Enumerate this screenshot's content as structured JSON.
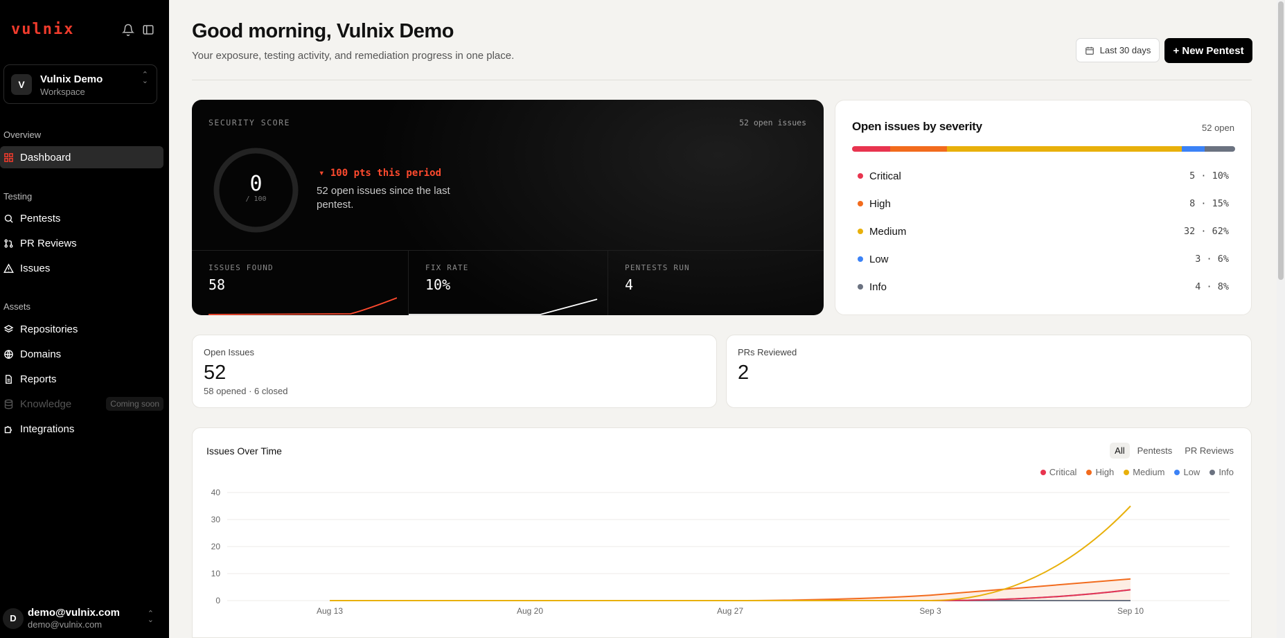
{
  "sidebar": {
    "logo": "vulnix",
    "workspace": {
      "avatar": "V",
      "name": "Vulnix Demo",
      "type": "Workspace"
    },
    "sections": {
      "overview": "Overview",
      "testing": "Testing",
      "assets": "Assets"
    },
    "items": [
      {
        "label": "Dashboard",
        "icon": "dashboard-icon",
        "active": true
      },
      {
        "label": "Pentests",
        "icon": "search-icon"
      },
      {
        "label": "PR Reviews",
        "icon": "git-pull-request-icon"
      },
      {
        "label": "Issues",
        "icon": "warning-triangle-icon"
      },
      {
        "label": "Repositories",
        "icon": "layers-icon"
      },
      {
        "label": "Domains",
        "icon": "globe-icon"
      },
      {
        "label": "Reports",
        "icon": "document-icon"
      },
      {
        "label": "Knowledge",
        "icon": "database-icon",
        "disabled": true,
        "badge": "Coming soon"
      },
      {
        "label": "Integrations",
        "icon": "puzzle-icon"
      }
    ],
    "user": {
      "avatar": "D",
      "email": "demo@vulnix.com",
      "sub": "demo@vulnix.com"
    }
  },
  "header": {
    "title": "Good morning, Vulnix Demo",
    "subtitle": "Your exposure, testing activity, and remediation progress in one place.",
    "range_label": "Last 30 days",
    "new_pentest_label": "+ New Pentest"
  },
  "security": {
    "label": "SECURITY SCORE",
    "open_issues": "52 open issues",
    "score": "0",
    "score_of": "/ 100",
    "delta": "▾ 100 pts this period",
    "delta_text": "52 open issues since the last pentest.",
    "stats": [
      {
        "label": "ISSUES FOUND",
        "value": "58"
      },
      {
        "label": "FIX RATE",
        "value": "10%"
      },
      {
        "label": "PENTESTS RUN",
        "value": "4"
      }
    ]
  },
  "severity": {
    "title": "Open issues by severity",
    "open": "52 open",
    "rows": [
      {
        "name": "Critical",
        "value": "5 · 10%",
        "color": "#e8344f",
        "pct": 10
      },
      {
        "name": "High",
        "value": "8 · 15%",
        "color": "#f26b1d",
        "pct": 15
      },
      {
        "name": "Medium",
        "value": "32 · 62%",
        "color": "#e8b00b",
        "pct": 62
      },
      {
        "name": "Low",
        "value": "3 · 6%",
        "color": "#3b82f6",
        "pct": 6
      },
      {
        "name": "Info",
        "value": "4 · 8%",
        "color": "#6b7280",
        "pct": 8
      }
    ]
  },
  "cards": {
    "open_issues": {
      "label": "Open Issues",
      "value": "52",
      "sub": "58 opened · 6 closed"
    },
    "prs_reviewed": {
      "label": "PRs Reviewed",
      "value": "2"
    }
  },
  "chart_section": {
    "title": "Issues Over Time",
    "tabs": [
      "All",
      "Pentests",
      "PR Reviews"
    ],
    "active_tab": "All"
  },
  "chart_data": {
    "type": "line",
    "x": [
      "Aug 13",
      "Aug 20",
      "Aug 27",
      "Sep 3",
      "Sep 10"
    ],
    "x_ticks": [
      "Aug 13",
      "Aug 20",
      "Aug 27",
      "Sep 3",
      "Sep 10"
    ],
    "y_ticks": [
      "0",
      "10",
      "20",
      "30",
      "40"
    ],
    "ylim": [
      0,
      40
    ],
    "grid": true,
    "legend_position": "top-right",
    "series": [
      {
        "name": "Critical",
        "color": "#e8344f",
        "values": [
          0,
          0,
          0,
          0,
          4
        ]
      },
      {
        "name": "High",
        "color": "#f26b1d",
        "values": [
          0,
          0,
          0,
          2,
          8
        ]
      },
      {
        "name": "Medium",
        "color": "#e8b00b",
        "values": [
          0,
          0,
          0,
          0,
          35
        ]
      },
      {
        "name": "Low",
        "color": "#3b82f6",
        "values": [
          0,
          0,
          0,
          0,
          4
        ]
      },
      {
        "name": "Info",
        "color": "#6b7280",
        "values": [
          0,
          0,
          0,
          0,
          0
        ]
      }
    ]
  }
}
